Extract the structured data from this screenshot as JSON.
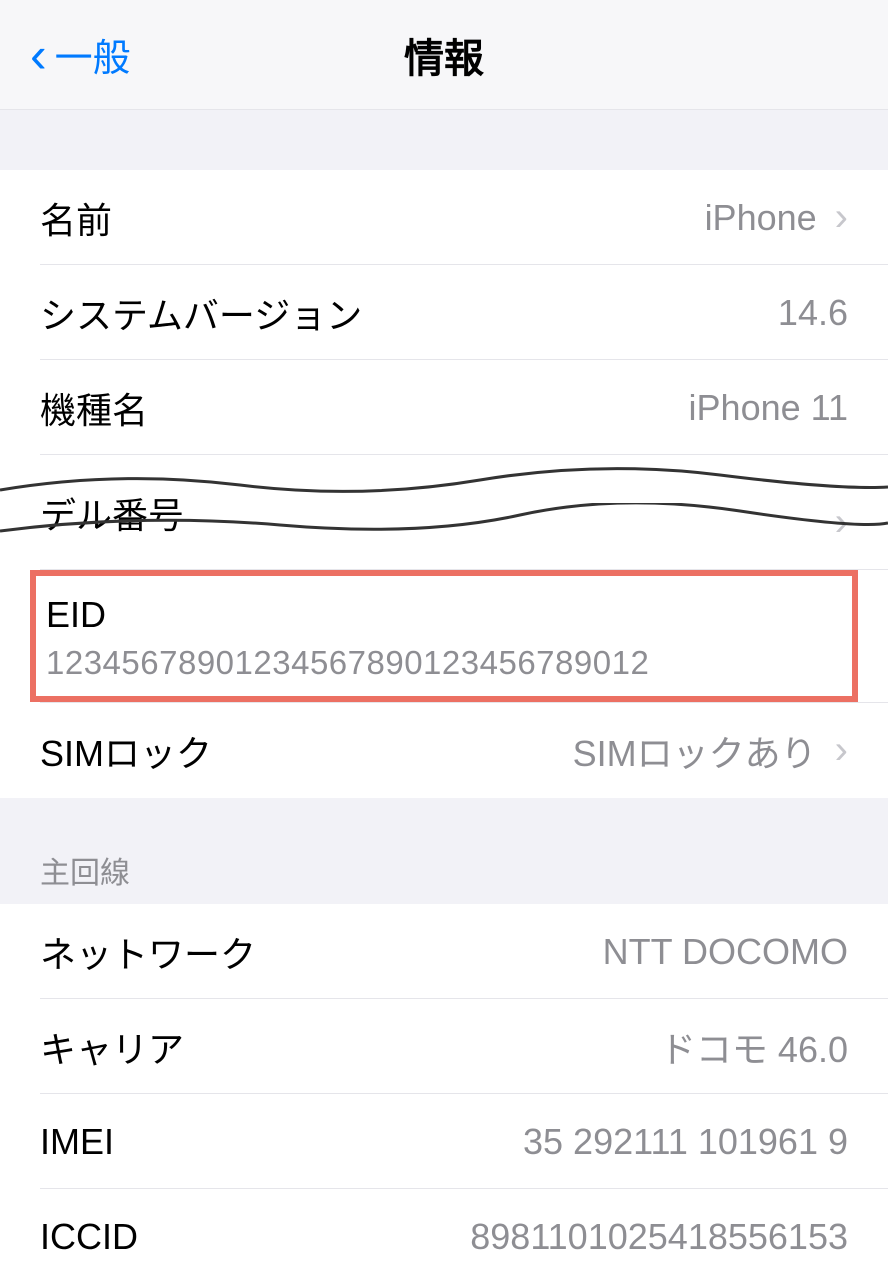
{
  "header": {
    "back_label": "一般",
    "title": "情報"
  },
  "section1": {
    "name": {
      "label": "名前",
      "value": "iPhone"
    },
    "version": {
      "label": "システムバージョン",
      "value": "14.6"
    },
    "model": {
      "label": "機種名",
      "value": "iPhone 11"
    },
    "partial_label": "デル番号"
  },
  "eid": {
    "label": "EID",
    "value": "12345678901234567890123456789012"
  },
  "sim_lock": {
    "label": "SIMロック",
    "value": "SIMロックあり"
  },
  "section2_header": "主回線",
  "section2": {
    "network": {
      "label": "ネットワーク",
      "value": "NTT DOCOMO"
    },
    "carrier": {
      "label": "キャリア",
      "value": "ドコモ 46.0"
    },
    "imei": {
      "label": "IMEI",
      "value": "35 292111 101961 9"
    },
    "iccid": {
      "label": "ICCID",
      "value": "8981101025418556153"
    }
  }
}
